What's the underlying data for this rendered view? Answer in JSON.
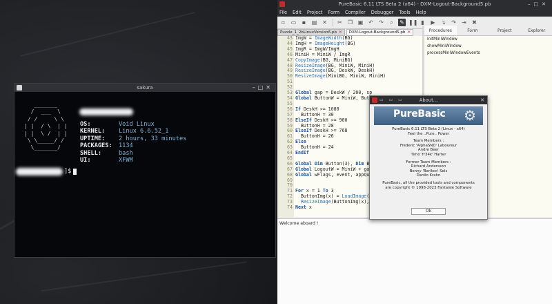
{
  "terminal": {
    "title": "sakura",
    "ascii_art": "   _______\n  /  ___  \\\n / /     \\ \\\n| |  / \\  | |\n| |  \\ /  | |\n \\ \\_____/ /\n  \\_______/",
    "info": [
      {
        "key": "OS:",
        "value": "Void Linux"
      },
      {
        "key": "KERNEL:",
        "value": "Linux 6.6.52_1"
      },
      {
        "key": "UPTIME:",
        "value": "2 hours, 33 minutes"
      },
      {
        "key": "PACKAGES:",
        "value": "1134"
      },
      {
        "key": "SHELL:",
        "value": "bash"
      },
      {
        "key": "UI:",
        "value": "XFWM"
      }
    ],
    "prompt_symbol": "]$"
  },
  "ide": {
    "title": "PureBasic 6.11 LTS Beta 2 (x64) - DXM-Logout-Background5.pb",
    "menu": [
      "File",
      "Edit",
      "Project",
      "Form",
      "Compiler",
      "Debugger",
      "Tools",
      "Help"
    ],
    "tabs": [
      {
        "label": "Puzzle_1_2bLinuxVersion6.pb",
        "active": false
      },
      {
        "label": "DXM-Logout-Background5.pb",
        "active": true
      }
    ],
    "code_lines": [
      {
        "n": "43",
        "code": "ImgW = ImageWidth(BG)"
      },
      {
        "n": "44",
        "code": "ImgH = ImageHeight(BG)"
      },
      {
        "n": "45",
        "code": "ImgR = ImgW/ImgH"
      },
      {
        "n": "46",
        "code": "MiniH = MiniW / ImgR"
      },
      {
        "n": "47",
        "code": "CopyImage(BG, MiniBG)"
      },
      {
        "n": "48",
        "code": "ResizeImage(BG, MiniW, MiniH)"
      },
      {
        "n": "49",
        "code": "ResizeImage(BG, DeskW, DeskH)"
      },
      {
        "n": "50",
        "code": "ResizeImage(MiniBG, MiniW, MiniH)"
      },
      {
        "n": "51",
        "code": ""
      },
      {
        "n": "52",
        "code": ""
      },
      {
        "n": "53",
        "code": "Global gap = DeskW / 200, sp"
      },
      {
        "n": "54",
        "code": "Global ButtonW = MiniW, Butt"
      },
      {
        "n": "55",
        "code": ""
      },
      {
        "n": "56",
        "code": "If DeskH >= 1080"
      },
      {
        "n": "57",
        "code": "  ButtonH = 30"
      },
      {
        "n": "58",
        "code": "ElseIf DeskH >= 900"
      },
      {
        "n": "59",
        "code": "  ButtonH = 28"
      },
      {
        "n": "60",
        "code": "ElseIf DeskH >= 768"
      },
      {
        "n": "61",
        "code": "  ButtonH = 26"
      },
      {
        "n": "62",
        "code": "Else"
      },
      {
        "n": "63",
        "code": "  ButtonH = 24"
      },
      {
        "n": "64",
        "code": "EndIf"
      },
      {
        "n": "65",
        "code": ""
      },
      {
        "n": "66",
        "code": "Global Dim Button(3), Dim Bu"
      },
      {
        "n": "67",
        "code": "Global LogoutW = MiniW + gap"
      },
      {
        "n": "68",
        "code": "Global wFlags, event, appQui"
      },
      {
        "n": "69",
        "code": ""
      },
      {
        "n": "70",
        "code": ""
      },
      {
        "n": "71",
        "code": "For x = 1 To 3"
      },
      {
        "n": "72",
        "code": "  ButtonImg(x) = LoadImage(a"
      },
      {
        "n": "73",
        "code": "  ResizeImage(ButtonImg(x),"
      },
      {
        "n": "74",
        "code": "Next x"
      }
    ],
    "panel_tabs": [
      "Procedures",
      "Form",
      "Project",
      "Explorer"
    ],
    "procedures": [
      "initMiniWindow",
      "showMiniWindow",
      "processMiniWindowEvents"
    ],
    "output_text": "Welcome aboard !"
  },
  "about": {
    "title": "About...",
    "logo_text": "PureBasic",
    "lines": [
      "PureBasic 6.11 LTS Beta 2 (Linux - x64)",
      "Feel the ..Pure.. Power",
      "",
      "Team Members :",
      "Frederic 'AlphaSND' Laboureur",
      "Andre Beer",
      "Timo 'fr34k' Harter",
      "",
      "Former Team Members :",
      "Richard Andersson",
      "Benny 'Berikco' Sels",
      "Danilo Krahn",
      "",
      "PureBasic, all the provided tools and components",
      "are copyright © 1998-2023 Fantaisie Software"
    ],
    "ok_label": "Ok"
  }
}
